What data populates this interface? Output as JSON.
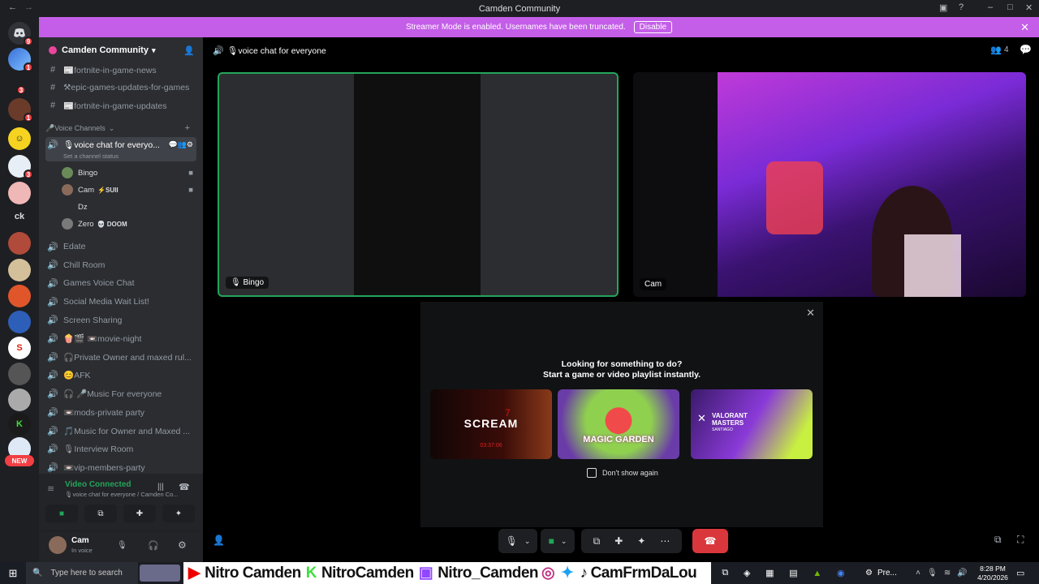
{
  "window": {
    "title": "Camden Community"
  },
  "banner": {
    "text": "Streamer Mode is enabled. Usernames have been truncated.",
    "disable_label": "Disable"
  },
  "servers": {
    "dm_badge": "9",
    "badges": [
      "1",
      "3",
      "1",
      "3"
    ],
    "text_icon": "ck",
    "new_badge": "NEW"
  },
  "guild": {
    "name": "Camden Community"
  },
  "channels": {
    "text": [
      {
        "name": "📰fortnite-in-game-news"
      },
      {
        "name": "⚒epic-games-updates-for-games"
      },
      {
        "name": "📰fortnite-in-game-updates"
      }
    ],
    "voice_category": "🎤Voice Channels",
    "active": {
      "name": "🎙voice chat for everyo...",
      "status": "Set a channel status"
    },
    "users": [
      {
        "name": "Bingo",
        "tag": ""
      },
      {
        "name": "Cam",
        "tag": "⚡SUII"
      },
      {
        "name": "Dz",
        "tag": ""
      },
      {
        "name": "Zero",
        "tag": "💀 DOOM"
      }
    ],
    "voice": [
      {
        "name": "Edate"
      },
      {
        "name": "Chill Room"
      },
      {
        "name": "Games Voice Chat"
      },
      {
        "name": "Social Media Wait List!"
      },
      {
        "name": "Screen Sharing"
      },
      {
        "name": "🍿🎬 📼movie-night"
      },
      {
        "name": "🎧Private Owner and maxed rul..."
      },
      {
        "name": "😊AFK"
      },
      {
        "name": "🎧 🎤Music For everyone"
      },
      {
        "name": "📼mods-private party"
      },
      {
        "name": "🎵Music for Owner and Maxed ..."
      },
      {
        "name": "🎙Interview Room"
      },
      {
        "name": "📼vip-members-party"
      }
    ]
  },
  "voice_connected": {
    "status": "Video Connected",
    "channel": "🎙voice chat for everyone / Camden Co..."
  },
  "user_panel": {
    "name": "Cam",
    "status": "In voice"
  },
  "header": {
    "channel": "🎙voice chat for everyone",
    "member_count": "4"
  },
  "tiles": [
    {
      "name": "Bingo"
    },
    {
      "name": "Cam"
    }
  ],
  "activity": {
    "heading": "Looking for something to do?",
    "subheading": "Start a game or video playlist instantly.",
    "games": [
      {
        "title": "SCREAM",
        "subtitle": "7",
        "timer": "03:37:06"
      },
      {
        "title": "MAGIC GARDEN"
      },
      {
        "title": "VALORANT MASTERS",
        "subtitle": "SANTIAGO"
      }
    ],
    "dont_show": "Don't show again"
  },
  "taskbar": {
    "search_placeholder": "Type here to search",
    "banner_items": [
      "Nitro Camden",
      "NitroCamden",
      "Nitro_Camden",
      "CamFrmDaLou"
    ],
    "tray_label": "Pre...",
    "time": "8:28 PM",
    "date": "4/20/2026"
  }
}
